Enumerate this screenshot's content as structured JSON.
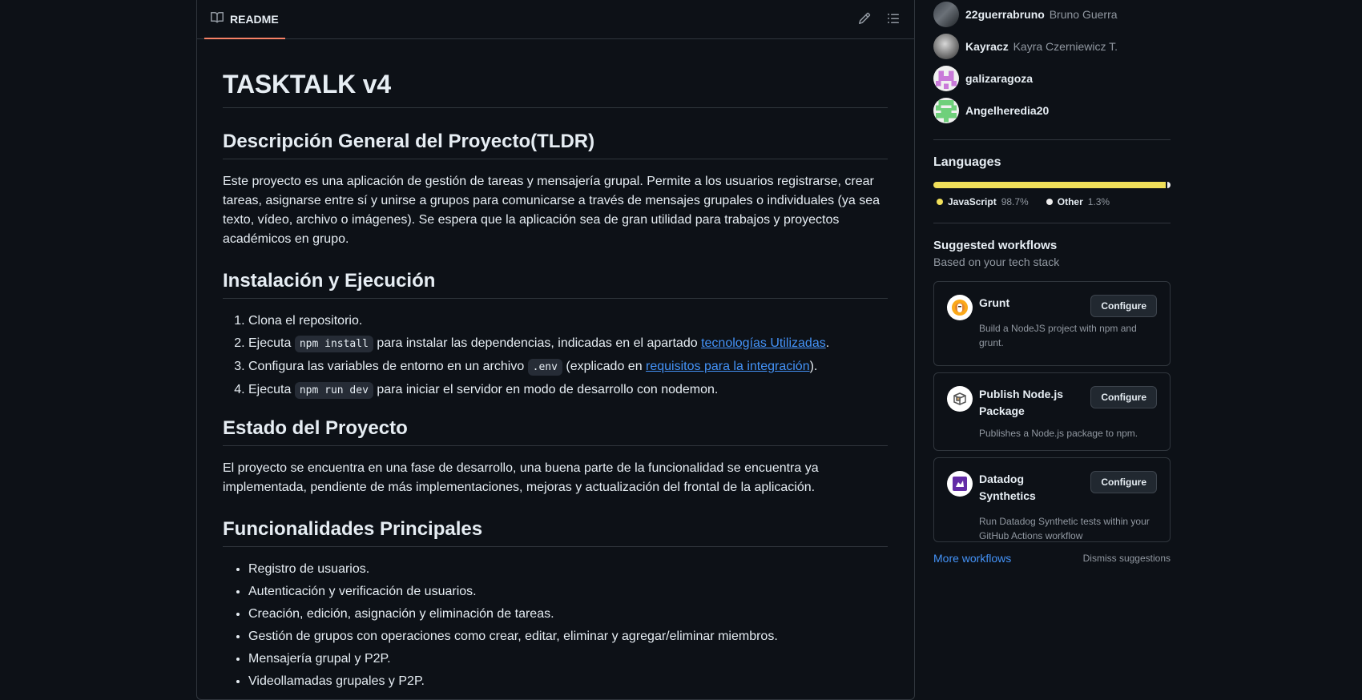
{
  "readme": {
    "tab_label": "README",
    "title": "TASKTALK v4",
    "s1_heading": "Descripción General del Proyecto(TLDR)",
    "s1_text": "Este proyecto es una aplicación de gestión de tareas y mensajería grupal. Permite a los usuarios registrarse, crear tareas, asignarse entre sí y unirse a grupos para comunicarse a través de mensajes grupales o individuales (ya sea texto, vídeo, archivo o imágenes). Se espera que la aplicación sea de gran utilidad para trabajos y proyectos académicos en grupo.",
    "s2_heading": "Instalación y Ejecución",
    "steps": {
      "s1": "Clona el repositorio.",
      "s2_pre": "Ejecuta ",
      "s2_code": "npm install",
      "s2_mid": " para instalar las dependencias, indicadas en el apartado ",
      "s2_link": "tecnologías Utilizadas",
      "s2_post": ".",
      "s3_pre": "Configura las variables de entorno en un archivo ",
      "s3_code": ".env",
      "s3_mid": " (explicado en ",
      "s3_link": "requisitos para la integración",
      "s3_post": ").",
      "s4_pre": "Ejecuta ",
      "s4_code": "npm run dev",
      "s4_post": " para iniciar el servidor en modo de desarrollo con nodemon."
    },
    "s3_heading": "Estado del Proyecto",
    "s3_text": "El proyecto se encuentra en una fase de desarrollo, una buena parte de la funcionalidad se encuentra ya implementada, pendiente de más implementaciones, mejoras y actualización del frontal de la aplicación.",
    "s4_heading": "Funcionalidades Principales",
    "features": [
      "Registro de usuarios.",
      "Autenticación y verificación de usuarios.",
      "Creación, edición, asignación y eliminación de tareas.",
      "Gestión de grupos con operaciones como crear, editar, eliminar y agregar/eliminar miembros.",
      "Mensajería grupal y P2P.",
      "Videollamadas grupales y P2P."
    ]
  },
  "contributors": [
    {
      "login": "22guerrabruno",
      "name": "Bruno Guerra"
    },
    {
      "login": "Kayracz",
      "name": "Kayra Czerniewicz T."
    },
    {
      "login": "galizaragoza",
      "name": ""
    },
    {
      "login": "Angelheredia20",
      "name": ""
    }
  ],
  "languages": {
    "heading": "Languages",
    "items": [
      {
        "name": "JavaScript",
        "percent": "98.7%",
        "value": 98.7,
        "color": "#f1e05a"
      },
      {
        "name": "Other",
        "percent": "1.3%",
        "value": 1.3,
        "color": "#ededed"
      }
    ]
  },
  "workflows": {
    "heading": "Suggested workflows",
    "subheading": "Based on your tech stack",
    "button_label": "Configure",
    "items": [
      {
        "title": "Grunt",
        "desc": "Build a NodeJS project with npm and grunt."
      },
      {
        "title": "Publish Node.js Package",
        "desc": "Publishes a Node.js package to npm."
      },
      {
        "title": "Datadog Synthetics",
        "desc": "Run Datadog Synthetic tests within your GitHub Actions workflow"
      }
    ],
    "more_link": "More workflows",
    "dismiss": "Dismiss suggestions"
  }
}
